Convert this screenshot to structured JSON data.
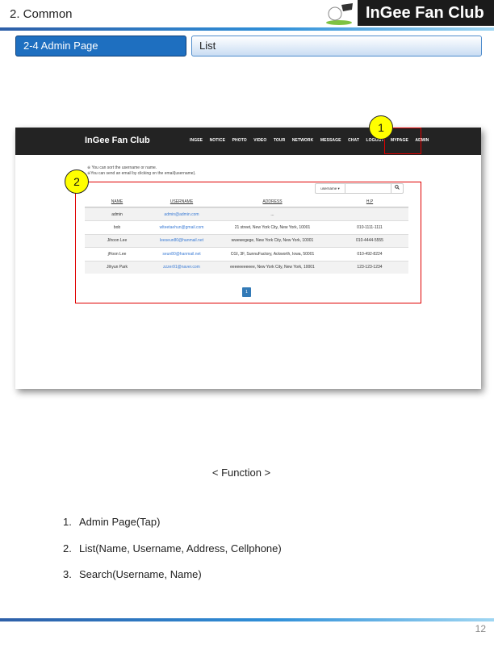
{
  "header": {
    "title": "2. Common",
    "brand": "InGee Fan Club"
  },
  "section": {
    "label": "2-4  Admin Page",
    "sub_label": "List"
  },
  "mock": {
    "brand": "InGee Fan Club",
    "menu": [
      "INGEE",
      "NOTICE",
      "PHOTO",
      "VIDEO",
      "TOUR",
      "NETWORK",
      "MESSAGE",
      "CHAT",
      "LOGOUT",
      "MYPAGE",
      "ADMIN"
    ],
    "notes": [
      "※ You can sort the username or name.",
      "※You can send an email by clicking on the email(username)."
    ],
    "search": {
      "select_label": "username ▾",
      "button_icon": "search-icon"
    },
    "table": {
      "headers": [
        "NAME",
        "USERNAME",
        "ADDRESS",
        "H.P"
      ],
      "rows": [
        [
          "admin",
          "admin@admin.com",
          "...",
          ""
        ],
        [
          "bob",
          "wlteetaehun@gmail.com",
          "21 street, New York City, New York, 10001",
          "010-1111-1111"
        ],
        [
          "Jihoon Lee",
          "leeseun80@hanmail.net",
          "wwewegege, New York City, New York, 10001",
          "010-4444-5555"
        ],
        [
          "jHoon Lee",
          "seun80@hanmail.net",
          "CGI, 3F, SunnuFactory, Ackworth, Iowa, 50001",
          "010-492-8224"
        ],
        [
          "Jihyun Park",
          "zzzer91@naver.com",
          "eeeeeeeeeee, New York City, New York, 10001",
          "123-123-1234"
        ]
      ]
    },
    "pager": "1"
  },
  "annotations": {
    "badge1": "1",
    "badge2": "2",
    "color": "#e00000"
  },
  "function": {
    "title": "< Function >",
    "items": [
      {
        "num": "1.",
        "text": "Admin Page(Tap)"
      },
      {
        "num": "2.",
        "text": "List(Name, Username, Address, Cellphone)"
      },
      {
        "num": "3.",
        "text": "Search(Username, Name)"
      }
    ]
  },
  "footer": {
    "page_number": "12"
  }
}
